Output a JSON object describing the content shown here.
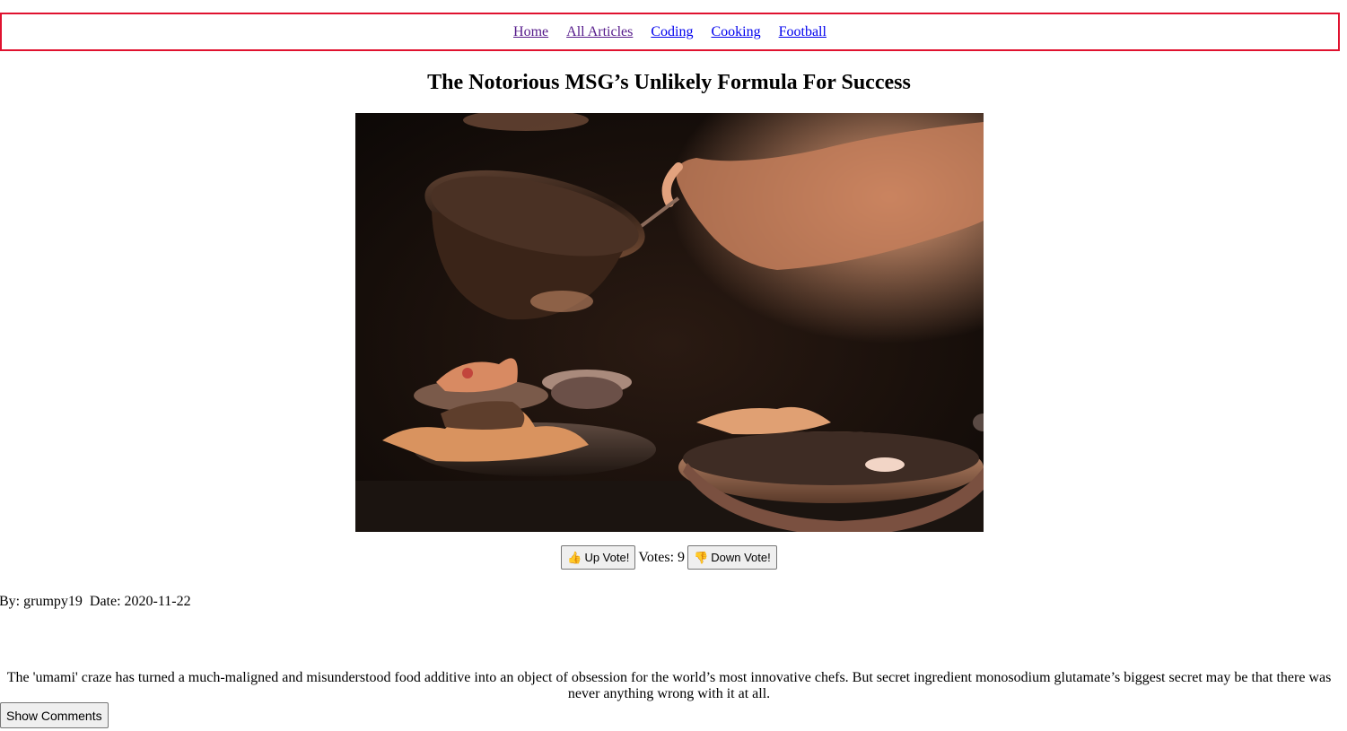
{
  "nav": {
    "links": [
      {
        "label": "Home"
      },
      {
        "label": "All Articles"
      },
      {
        "label": "Coding"
      },
      {
        "label": "Cooking"
      },
      {
        "label": "Football"
      }
    ]
  },
  "article": {
    "title": "The Notorious MSG’s Unlikely Formula For Success",
    "byline": "By: grumpy19  Date: 2020-11-22",
    "summary": "The 'umami' craze has turned a much-maligned and misunderstood food additive into an object of obsession for the world’s most innovative chefs. But secret ingredient monosodium glutamate’s biggest secret may be that there was never anything wrong with it at all."
  },
  "votes": {
    "up_icon": "👍",
    "up_label": "Up Vote!",
    "count_text": "Votes: 9",
    "down_icon": "👎",
    "down_label": "Down Vote!"
  },
  "comments": {
    "toggle_label": "Show Comments"
  },
  "colors": {
    "nav_border": "#e0122f",
    "link_visited": "#551a8b",
    "link_unvisited": "#0000ee"
  }
}
